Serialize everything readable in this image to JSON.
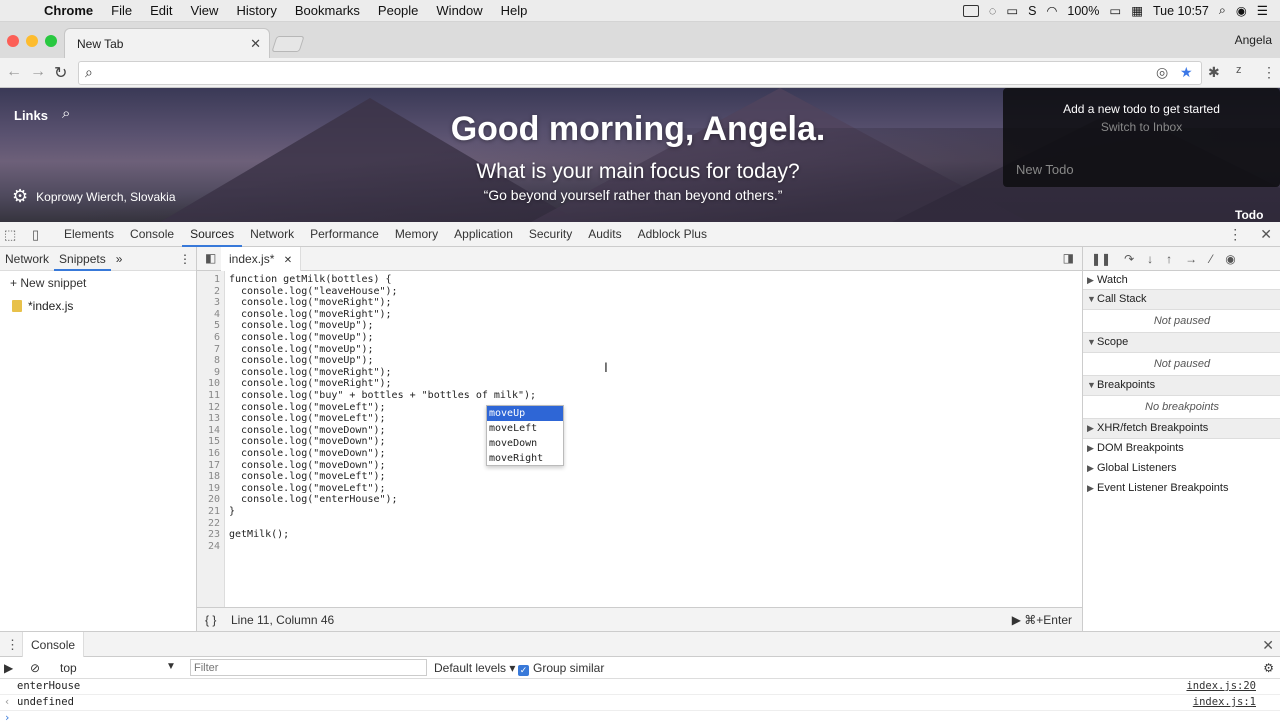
{
  "menubar": {
    "app": "Chrome",
    "items": [
      "File",
      "Edit",
      "View",
      "History",
      "Bookmarks",
      "People",
      "Window",
      "Help"
    ],
    "battery": "100%",
    "clock": "Tue 10:57"
  },
  "browser": {
    "tab_title": "New Tab",
    "profile": "Angela",
    "omnibox_value": ""
  },
  "page": {
    "links": "Links",
    "greeting": "Good morning, Angela.",
    "focus_question": "What is your main focus for today?",
    "quote": "“Go beyond yourself rather than beyond others.”",
    "location": "Koprowy Wierch, Slovakia",
    "todo": {
      "line1": "Add a new todo to get started",
      "line2": "Switch to Inbox",
      "placeholder": "New Todo",
      "label": "Todo"
    }
  },
  "devtools": {
    "tabs": [
      "Elements",
      "Console",
      "Sources",
      "Network",
      "Performance",
      "Memory",
      "Application",
      "Security",
      "Audits",
      "Adblock Plus"
    ],
    "navigator": {
      "tabs": [
        "Network",
        "Snippets"
      ],
      "new_snippet": "New snippet",
      "file": "*index.js"
    },
    "editor": {
      "tab": "index.js*",
      "status": "Line 11, Column 46",
      "run": "⌘+Enter",
      "line_numbers": [
        "1",
        "2",
        "3",
        "4",
        "5",
        "6",
        "7",
        "8",
        "9",
        "10",
        "11",
        "12",
        "13",
        "14",
        "15",
        "16",
        "17",
        "18",
        "19",
        "20",
        "21",
        "22",
        "23",
        "24"
      ],
      "lines": [
        "function getMilk(bottles) {",
        "  console.log(\"leaveHouse\");",
        "  console.log(\"moveRight\");",
        "  console.log(\"moveRight\");",
        "  console.log(\"moveUp\");",
        "  console.log(\"moveUp\");",
        "  console.log(\"moveUp\");",
        "  console.log(\"moveUp\");",
        "  console.log(\"moveRight\");",
        "  console.log(\"moveRight\");",
        "  console.log(\"buy\" + bottles + \"bottles of milk\");",
        "  console.log(\"moveLeft\");",
        "  console.log(\"moveLeft\");",
        "  console.log(\"moveDown\");",
        "  console.log(\"moveDown\");",
        "  console.log(\"moveDown\");",
        "  console.log(\"moveDown\");",
        "  console.log(\"moveLeft\");",
        "  console.log(\"moveLeft\");",
        "  console.log(\"enterHouse\");",
        "}",
        "",
        "getMilk();",
        ""
      ],
      "autocomplete": [
        "moveUp",
        "moveLeft",
        "moveDown",
        "moveRight"
      ]
    },
    "debugger": {
      "sections": [
        "Watch",
        "Call Stack",
        "Scope",
        "Breakpoints",
        "XHR/fetch Breakpoints",
        "DOM Breakpoints",
        "Global Listeners",
        "Event Listener Breakpoints"
      ],
      "not_paused": "Not paused",
      "no_breakpoints": "No breakpoints"
    },
    "console": {
      "tab": "Console",
      "context": "top",
      "filter_placeholder": "Filter",
      "levels": "Default levels",
      "group_similar": "Group similar",
      "logs": [
        {
          "msg": "enterHouse",
          "src": "index.js:20"
        },
        {
          "msg": "undefined",
          "src": "index.js:1"
        }
      ]
    }
  }
}
